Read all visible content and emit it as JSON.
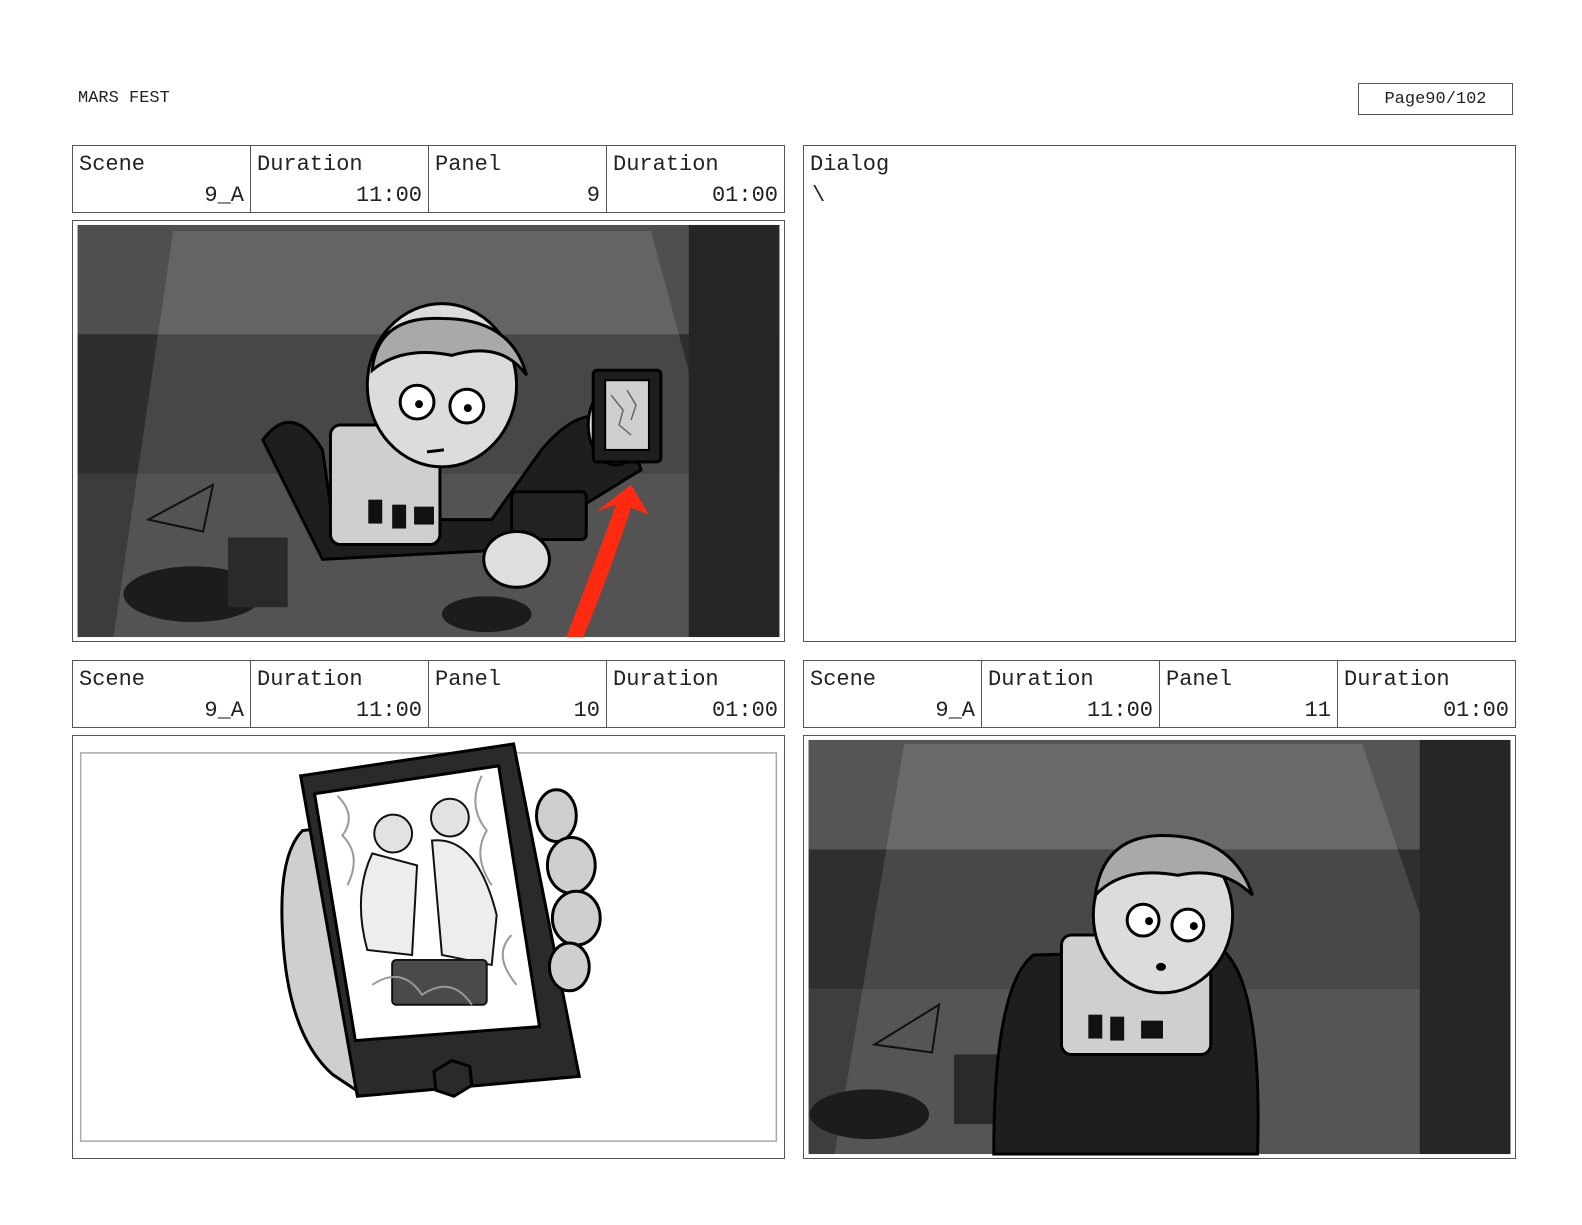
{
  "document": {
    "title": "MARS FEST",
    "page_label": "Page",
    "page_number": "90/102"
  },
  "labels": {
    "scene": "Scene",
    "duration": "Duration",
    "panel": "Panel",
    "dialog": "Dialog"
  },
  "panels": [
    {
      "scene": "9_A",
      "scene_duration": "11:00",
      "panel": "9",
      "panel_duration": "01:00"
    },
    {
      "scene": "9_A",
      "scene_duration": "11:00",
      "panel": "10",
      "panel_duration": "01:00"
    },
    {
      "scene": "9_A",
      "scene_duration": "11:00",
      "panel": "11",
      "panel_duration": "01:00"
    }
  ],
  "dialog_text": "\\",
  "colors": {
    "arrow": "#ff2a10",
    "dark": "#1e1e1e",
    "mid": "#4a4a4a",
    "light": "#9a9a9a"
  }
}
